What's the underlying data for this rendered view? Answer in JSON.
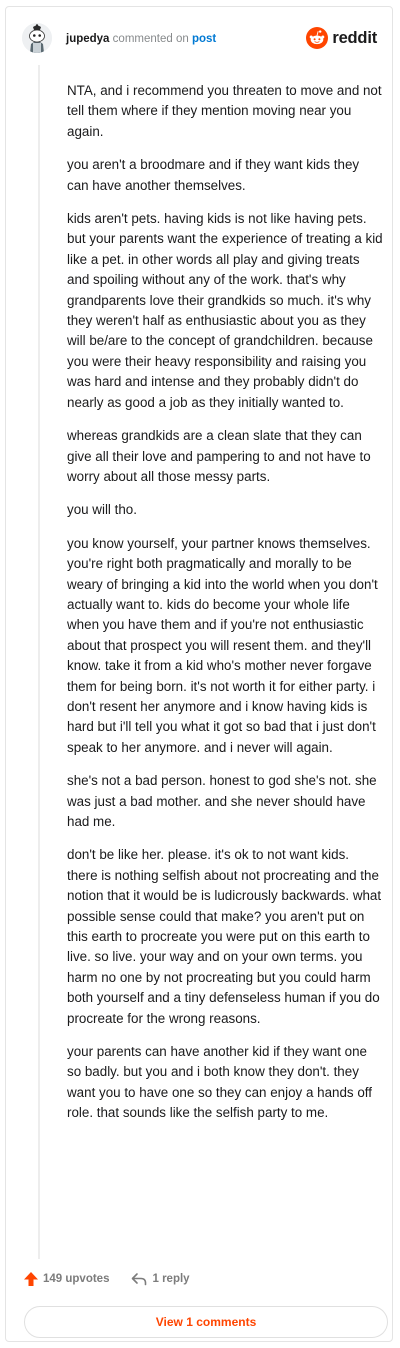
{
  "comment": {
    "username": "jupedya",
    "action_text": "commented on",
    "post_link": "post",
    "paragraphs": [
      "NTA, and i recommend you threaten to move and not tell them where if they mention moving near you again.",
      "you aren't a broodmare and if they want kids they can have another themselves.",
      "kids aren't pets. having kids is not like having pets. but your parents want the experience of treating a kid like a pet. in other words all play and giving treats and spoiling without any of the work. that's why grandparents love their grandkids so much. it's why they weren't half as enthusiastic about you as they will be/are to the concept of grandchildren. because you were their heavy responsibility and raising you was hard and intense and they probably didn't do nearly as good a job as they initially wanted to.",
      "whereas grandkids are a clean slate that they can give all their love and pampering to and not have to worry about all those messy parts.",
      "you will tho.",
      "you know yourself, your partner knows themselves. you're right both pragmatically and morally to be weary of bringing a kid into the world when you don't actually want to. kids do become your whole life when you have them and if you're not enthusiastic about that prospect you will resent them. and they'll know. take it from a kid who's mother never forgave them for being born. it's not worth it for either party. i don't resent her anymore and i know having kids is hard but i'll tell you what it got so bad that i just don't speak to her anymore. and i never will again.",
      "she's not a bad person. honest to god she's not. she was just a bad mother. and she never should have had me.",
      "don't be like her. please. it's ok to not want kids. there is nothing selfish about not procreating and the notion that it would be is ludicrously backwards. what possible sense could that make? you aren't put on this earth to procreate you were put on this earth to live. so live. your way and on your own terms. you harm no one by not procreating but you could harm both yourself and a tiny defenseless human if you do procreate for the wrong reasons.",
      "your parents can have another kid if they want one so badly. but you and i both know they don't. they want you to have one so they can enjoy a hands off role. that sounds like the selfish party to me."
    ],
    "upvotes": "149 upvotes",
    "replies": "1 reply",
    "view_comments": "View 1 comments"
  },
  "brand": {
    "name": "reddit",
    "icon": "reddit-snoo-icon",
    "color": "#ff4500"
  },
  "icons": {
    "upvote": "upvote-arrow-icon",
    "reply": "reply-arrow-icon",
    "avatar": "snoo-avatar"
  },
  "colors": {
    "upvote": "#ff4500",
    "link": "#0079d3",
    "meta": "#878a8c"
  }
}
